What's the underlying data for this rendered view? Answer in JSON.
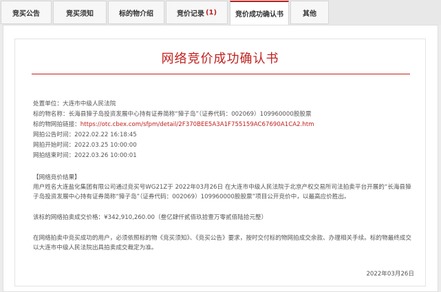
{
  "tabs": [
    {
      "label": "竞买公告",
      "active": false
    },
    {
      "label": "竞买须知",
      "active": false
    },
    {
      "label": "标的物介绍",
      "active": false
    },
    {
      "label": "竞价记录",
      "count": "(1)",
      "active": false
    },
    {
      "label": "竞价成功确认书",
      "active": true
    },
    {
      "label": "其他",
      "active": false
    }
  ],
  "doc": {
    "title": "网络竞价成功确认书",
    "unit_label": "处置单位：",
    "unit_value": "大连市中级人民法院",
    "name_label": "标的物名称：",
    "name_value": "长海县獐子岛投资发展中心持有证券简称“獐子岛”（证券代码：002069）109960000股股票",
    "link_label": "标的物网拍链接：",
    "link_value": "https://otc.cbex.com/sfpm/detail/2F370BEE5A3A1F755159AC67690A1CA2.htm",
    "announce_label": "网拍公告时间：",
    "announce_value": "2022.02.22 16:18:45",
    "start_label": "网拍开始时间：",
    "start_value": "2022.03.25 10:00:00",
    "end_label": "网拍结束时间：",
    "end_value": "2022.03.26 10:00:01",
    "result_heading": "【网络竞价结果】",
    "result_text": "用户姓名大连盐化集团有限公司通过竞买号WG21Z于 2022年03月26日 在大连市中级人民法院于北京产权交易所司法拍卖平台开展的“长海县獐子岛投资发展中心持有证券简称“獐子岛”（证券代码：002069）109960000股股票”项目公开竞价中，以最高应价胜出。",
    "price_label": "该标的网络拍卖成交价格：",
    "price_value": "¥342,910,260.00（叁亿肆仟贰佰玖拾壹万零贰佰陆拾元整）",
    "notice_text": "在网络拍卖中竞买成功的用户，必须依照标的物《竞买须知》、《竞买公告》要求，按时交付标的物网拍成交余款、办理相关手续。标的物最终成交以大连市中级人民法院出具拍卖成交裁定为准。",
    "date": "2022年03月26日"
  }
}
